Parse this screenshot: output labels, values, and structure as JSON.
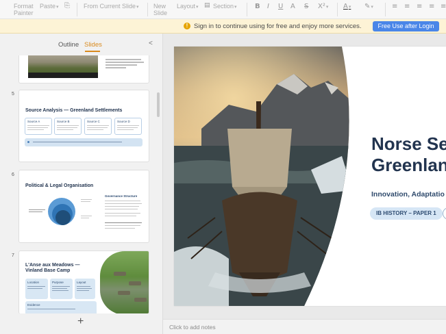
{
  "toolbar": {
    "format_painter": "Format\nPainter",
    "paste": "Paste",
    "from_current_slide": "From Current Slide",
    "new_slide": "New\nSlide",
    "layout": "Layout",
    "section": "Section"
  },
  "notice": {
    "message": "Sign in to continue using for free and enjoy more services.",
    "button": "Free Use after Login"
  },
  "panel": {
    "tab_outline": "Outline",
    "tab_slides": "Slides",
    "slides": [
      {
        "number": "5",
        "title": "Source Analysis — Greenland Settlements",
        "sources": [
          "Source A",
          "Source B",
          "Source C",
          "Source D"
        ]
      },
      {
        "number": "6",
        "title": "Political & Legal Organisation",
        "side_heading": "Governance Structure"
      },
      {
        "number": "7",
        "title_line1": "L'Anse aux Meadows —",
        "title_line2": "Vinland Base Camp",
        "boxes": [
          "Location",
          "Purpose",
          "Layout",
          "Evidence"
        ]
      }
    ]
  },
  "slide": {
    "title_line1": "Norse Se",
    "title_line2": "Greenlan",
    "subtitle": "Innovation, Adaptatio",
    "tag": "IB HISTORY – PAPER 1"
  },
  "notes_placeholder": "Click to add notes",
  "colors": {
    "accent": "#d98a1e",
    "button_blue": "#4a86e8",
    "title_navy": "#22344f",
    "notice_bg": "#fdf3d6"
  }
}
